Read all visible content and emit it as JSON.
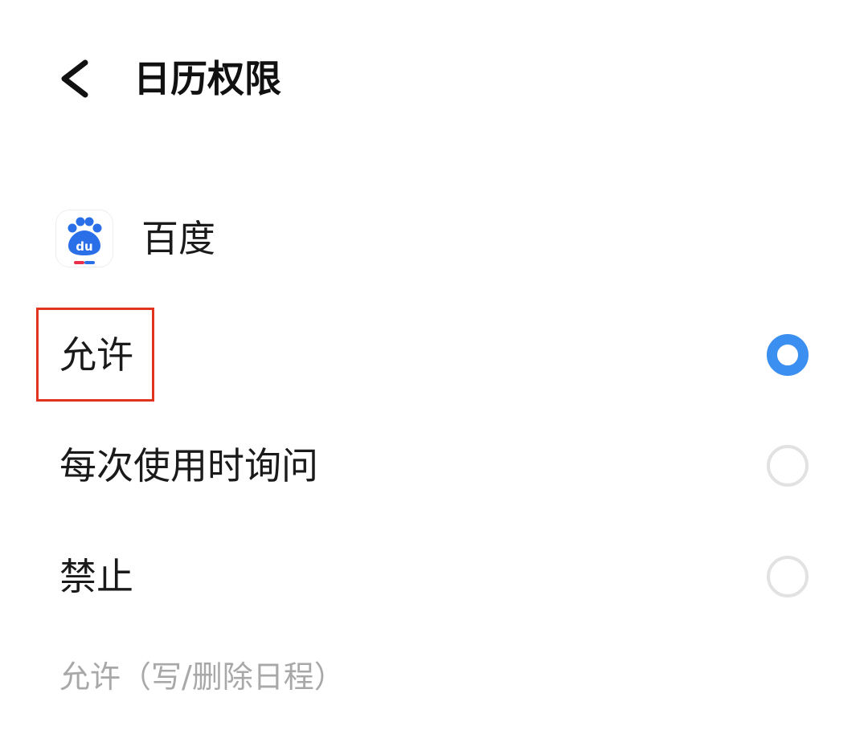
{
  "header": {
    "back_icon": "chevron-left-icon",
    "title": "日历权限"
  },
  "app": {
    "icon": "baidu-paw-logo",
    "logo_text": "du",
    "name": "百度"
  },
  "options": [
    {
      "label": "允许",
      "selected": true
    },
    {
      "label": "每次使用时询问",
      "selected": false
    },
    {
      "label": "禁止",
      "selected": false
    }
  ],
  "footnote": "允许（写/删除日程）",
  "colors": {
    "accent": "#3b8ff0",
    "highlight": "#e0341f",
    "muted_text": "#a8a8a8",
    "radio_border": "#e2e2e2"
  }
}
